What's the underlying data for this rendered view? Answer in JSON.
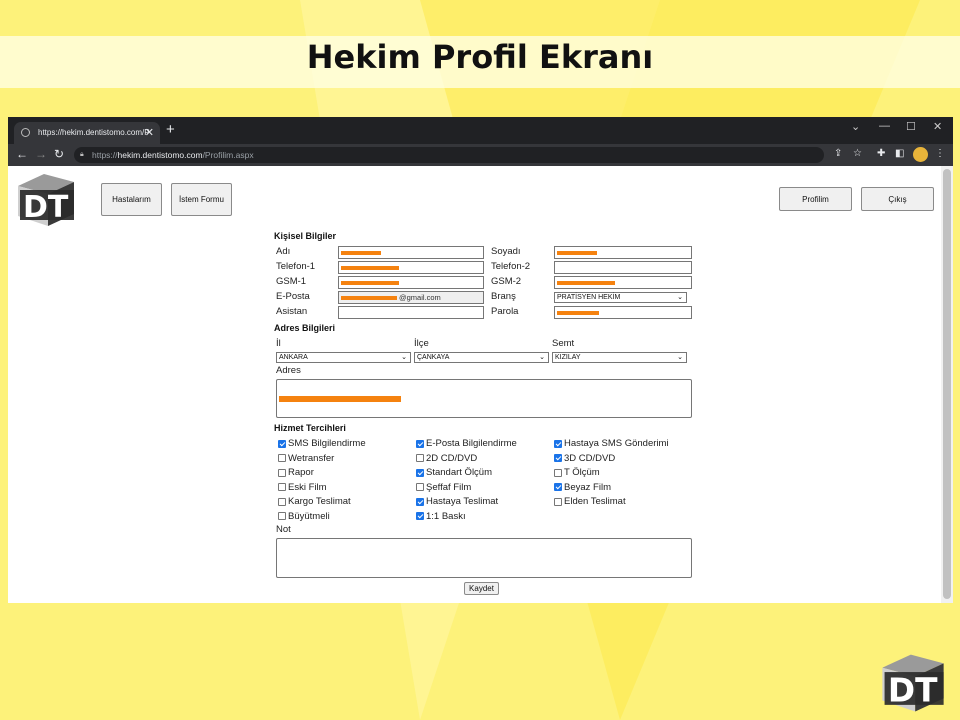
{
  "slide": {
    "title": "Hekim Profil Ekranı"
  },
  "browser": {
    "tab_title": "https://hekim.dentistomo.com/P",
    "url_prefix": "https://",
    "url_host": "hekim.dentistomo.com",
    "url_path": "/Profilim.aspx"
  },
  "nav": {
    "hastalarim": "Hastalarım",
    "istem_formu": "İstem Formu",
    "profilim": "Profilim",
    "cikis": "Çıkış"
  },
  "kisisel": {
    "title": "Kişisel Bilgiler",
    "adi": "Adı",
    "soyadi": "Soyadı",
    "telefon1": "Telefon-1",
    "telefon2": "Telefon-2",
    "gsm1": "GSM-1",
    "gsm2": "GSM-2",
    "eposta": "E-Posta",
    "brans": "Branş",
    "asistan": "Asistan",
    "parola": "Parola",
    "eposta_suffix": "@gmail.com",
    "brans_value": "PRATİSYEN HEKİM"
  },
  "adres": {
    "title": "Adres Bilgileri",
    "il": "İl",
    "ilce": "İlçe",
    "semt": "Semt",
    "adres": "Adres",
    "il_value": "ANKARA",
    "ilce_value": "ÇANKAYA",
    "semt_value": "KIZILAY"
  },
  "hizmet": {
    "title": "Hizmet Tercihleri",
    "options": [
      {
        "label": "SMS Bilgilendirme",
        "checked": true
      },
      {
        "label": "E-Posta Bilgilendirme",
        "checked": true
      },
      {
        "label": "Hastaya SMS Gönderimi",
        "checked": true
      },
      {
        "label": "Wetransfer",
        "checked": false
      },
      {
        "label": "2D CD/DVD",
        "checked": false
      },
      {
        "label": "3D CD/DVD",
        "checked": true
      },
      {
        "label": "Rapor",
        "checked": false
      },
      {
        "label": "Standart Ölçüm",
        "checked": true
      },
      {
        "label": "T Ölçüm",
        "checked": false
      },
      {
        "label": "Eski Film",
        "checked": false
      },
      {
        "label": "Şeffaf Film",
        "checked": false
      },
      {
        "label": "Beyaz Film",
        "checked": true
      },
      {
        "label": "Kargo Teslimat",
        "checked": false
      },
      {
        "label": "Hastaya Teslimat",
        "checked": true
      },
      {
        "label": "Elden Teslimat",
        "checked": false
      },
      {
        "label": "Büyütmeli",
        "checked": false
      },
      {
        "label": "1:1 Baskı",
        "checked": true
      }
    ],
    "not": "Not",
    "kaydet": "Kaydet"
  },
  "colors": {
    "redaction": "#f5820f",
    "slide_bg": "#fdf27a",
    "chrome_dark": "#202124"
  }
}
